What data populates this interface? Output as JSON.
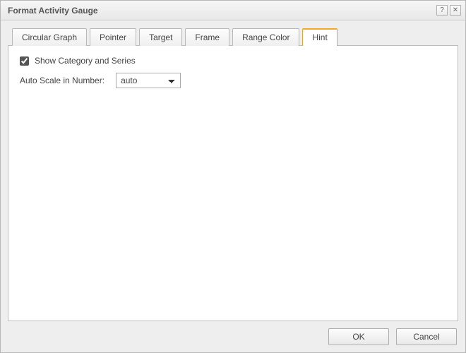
{
  "window": {
    "title": "Format Activity Gauge",
    "help_icon": "?",
    "close_icon": "✕"
  },
  "tabs": {
    "items": [
      {
        "label": "Circular Graph"
      },
      {
        "label": "Pointer"
      },
      {
        "label": "Target"
      },
      {
        "label": "Frame"
      },
      {
        "label": "Range Color"
      },
      {
        "label": "Hint"
      }
    ],
    "active_index": 5
  },
  "hint": {
    "show_category_checked": true,
    "show_category_label": "Show Category and Series",
    "auto_scale_label": "Auto Scale in Number:",
    "auto_scale_value": "auto"
  },
  "footer": {
    "ok": "OK",
    "cancel": "Cancel"
  }
}
